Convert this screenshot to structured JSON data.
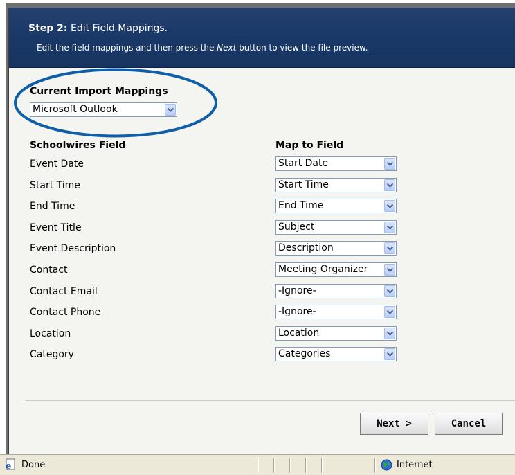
{
  "header": {
    "step_label": "Step 2:",
    "step_title": "Edit Field Mappings.",
    "desc_before": "Edit the field mappings and then press the ",
    "desc_italic": "Next",
    "desc_after": " button to view the file preview."
  },
  "current_mappings": {
    "title": "Current Import Mappings",
    "selected": "Microsoft Outlook"
  },
  "columns": {
    "left": "Schoolwires Field",
    "right": "Map to Field"
  },
  "rows": [
    {
      "field": "Event Date",
      "map": "Start Date"
    },
    {
      "field": "Start Time",
      "map": "Start Time"
    },
    {
      "field": "End Time",
      "map": "End Time"
    },
    {
      "field": "Event Title",
      "map": "Subject"
    },
    {
      "field": "Event Description",
      "map": "Description"
    },
    {
      "field": "Contact",
      "map": "Meeting Organizer"
    },
    {
      "field": "Contact Email",
      "map": "-Ignore-"
    },
    {
      "field": "Contact Phone",
      "map": "-Ignore-"
    },
    {
      "field": "Location",
      "map": "Location"
    },
    {
      "field": "Category",
      "map": "Categories"
    }
  ],
  "buttons": {
    "next": "Next >",
    "cancel": "Cancel"
  },
  "statusbar": {
    "status": "Done",
    "zone": "Internet"
  },
  "colors": {
    "header_bg": "#1b3a6a",
    "highlight_oval": "#0f5fa8"
  }
}
